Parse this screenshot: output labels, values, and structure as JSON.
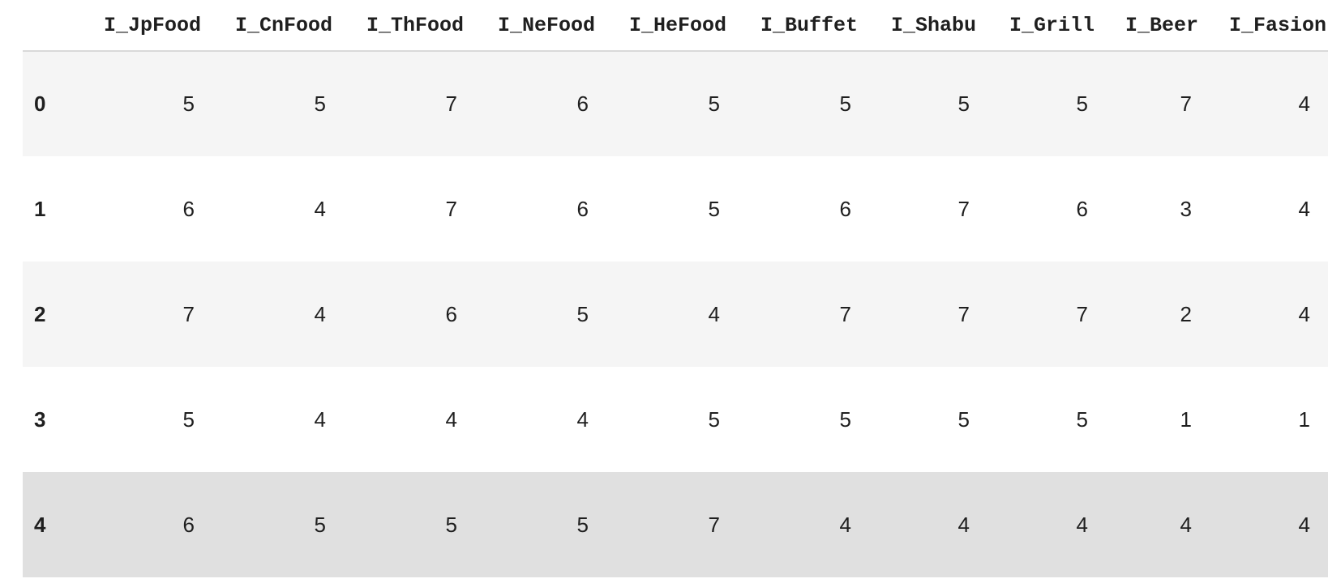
{
  "dataframe": {
    "columns": [
      "I_JpFood",
      "I_CnFood",
      "I_ThFood",
      "I_NeFood",
      "I_HeFood",
      "I_Buffet",
      "I_Shabu",
      "I_Grill",
      "I_Beer",
      "I_Fasion"
    ],
    "rows": [
      {
        "index": "0",
        "values": [
          "5",
          "5",
          "7",
          "6",
          "5",
          "5",
          "5",
          "5",
          "7",
          "4"
        ]
      },
      {
        "index": "1",
        "values": [
          "6",
          "4",
          "7",
          "6",
          "5",
          "6",
          "7",
          "6",
          "3",
          "4"
        ]
      },
      {
        "index": "2",
        "values": [
          "7",
          "4",
          "6",
          "5",
          "4",
          "7",
          "7",
          "7",
          "2",
          "4"
        ]
      },
      {
        "index": "3",
        "values": [
          "5",
          "4",
          "4",
          "4",
          "5",
          "5",
          "5",
          "5",
          "1",
          "1"
        ]
      },
      {
        "index": "4",
        "values": [
          "6",
          "5",
          "5",
          "5",
          "7",
          "4",
          "4",
          "4",
          "4",
          "4"
        ]
      }
    ],
    "hovered_row": 4,
    "colors": {
      "odd_row_bg": "#f5f5f5",
      "even_row_bg": "#ffffff",
      "hover_row_bg": "#e0e0e0",
      "text": "#1f1f1f",
      "header_rule": "#d9d9d9"
    }
  }
}
